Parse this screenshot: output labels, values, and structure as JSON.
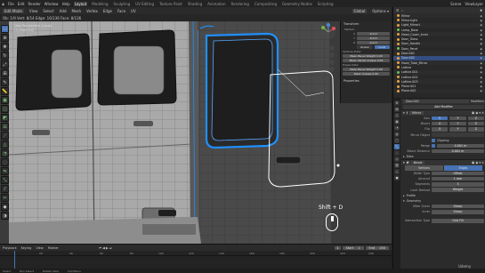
{
  "topbar": {
    "menus": [
      "File",
      "Edit",
      "Render",
      "Window",
      "Help"
    ],
    "workspaces": [
      "Layout",
      "Modeling",
      "Sculpting",
      "UV Editing",
      "Texture Paint",
      "Shading",
      "Animation",
      "Rendering",
      "Compositing",
      "Geometry Nodes",
      "Scripting"
    ],
    "active_workspace": "Layout",
    "scene": "Scene",
    "view_layer": "ViewLayer"
  },
  "viewport_header": {
    "mode": "Edit Mode",
    "menus": [
      "View",
      "Select",
      "Add",
      "Mesh",
      "Vertex",
      "Edge",
      "Face",
      "UV"
    ],
    "orientation": "Global",
    "stats": "Ob: 1/9 Vert: 8/14 Edge: 16/136 Face: 8/136"
  },
  "viewport_overlay": {
    "line1": "User Perspective (Local)",
    "line2": "(1) Door.002"
  },
  "npanel": {
    "title": "Transform",
    "median_label": "Median:",
    "x_label": "X",
    "x_value": "-0.0 m",
    "y_label": "Y",
    "y_value": "-0.0 m",
    "z_label": "Z",
    "z_value": "-0.0 m",
    "global_label": "Global",
    "local_label": "Local",
    "edge_data_label": "Vertices Data:",
    "mean_bevel_label": "Mean Bevel Weight",
    "mean_bevel_value": "0.00",
    "mean_crease_label": "Mean Vertex Crease",
    "mean_crease_value": "0.00",
    "edges_data_label": "Edges Data:",
    "edge_bevel_label": "Mean Bevel Weight",
    "edge_bevel_value": "0.00",
    "edge_crease_label": "Mean Crease",
    "edge_crease_value": "0.00",
    "properties_label": "Properties"
  },
  "hint": {
    "shortcut": "Shift + D"
  },
  "timeline": {
    "menus": [
      "Playback",
      "Keying",
      "View",
      "Marker"
    ],
    "current_frame": "1",
    "start_label": "Start",
    "start": "1",
    "end_label": "End",
    "end": "250",
    "ruler": [
      "20",
      "40",
      "60",
      "80",
      "100",
      "120",
      "140",
      "160",
      "180",
      "200",
      "220",
      "240"
    ]
  },
  "statusbar": {
    "items": [
      "Select",
      "Box Select",
      "Rotate View",
      "Call Menu"
    ]
  },
  "outliner": {
    "items": [
      {
        "name": "Mirror",
        "color": "#e8a33f"
      },
      {
        "name": "MirrorLight",
        "color": "#e8a33f"
      },
      {
        "name": "Light_MirrorL",
        "color": "#e8a33f"
      },
      {
        "name": "Lamp_Base",
        "color": "#6fbf5a"
      },
      {
        "name": "Head_Cover_Inner",
        "color": "#e8a33f"
      },
      {
        "name": "Door_Glass",
        "color": "#e8a33f"
      },
      {
        "name": "Door_Handle",
        "color": "#e8a33f"
      },
      {
        "name": "Door_Panel",
        "color": "#6fbf5a"
      },
      {
        "name": "Door.001",
        "color": "#e8a33f"
      },
      {
        "name": "Door.002",
        "color": "#e8a33f"
      },
      {
        "name": "Hood_Tube_Mirror",
        "color": "#e8a33f"
      },
      {
        "name": "Lattice",
        "color": "#e8a33f"
      },
      {
        "name": "Lattice.001",
        "color": "#6fbf5a"
      },
      {
        "name": "Lattice.002",
        "color": "#e8a33f"
      },
      {
        "name": "Lattice.003",
        "color": "#e8a33f"
      },
      {
        "name": "Plane.001",
        "color": "#e8a33f"
      },
      {
        "name": "Plane.002",
        "color": "#e8a33f"
      }
    ]
  },
  "properties": {
    "object_name": "Door.002",
    "modifier_tab": "Modifiers",
    "add_modifier": "Add Modifier",
    "mirror": {
      "name": "Mirror",
      "axis_label": "Axis",
      "bisect_label": "Bisect",
      "flip_label": "Flip",
      "x": "X",
      "y": "Y",
      "z": "Z",
      "mirror_object_label": "Mirror Object",
      "clipping_label": "Clipping",
      "merge_label": "Merge",
      "merge_value": "0.001 m",
      "bisect_distance_label": "Bisect Distance",
      "bisect_distance_value": "0.001 m",
      "data_label": "Data"
    },
    "bevel": {
      "name": "Bevel",
      "vertices_tab": "Vertices",
      "edges_tab": "Edges",
      "width_type_label": "Width Type",
      "width_type_value": "Offset",
      "amount_label": "Amount",
      "amount_value": "1 mm",
      "segments_label": "Segments",
      "segments_value": "3",
      "limit_method_label": "Limit Method",
      "limit_method_value": "Weight",
      "profile_label": "Profile",
      "geometry_label": "Geometry",
      "miter_outer_label": "Miter Outer",
      "miter_outer_value": "Sharp",
      "inner_label": "Inner",
      "inner_value": "Sharp",
      "intersection_label": "Intersection Type",
      "intersection_value": "Grid Fill"
    }
  },
  "watermark": "Udemy",
  "colors": {
    "accent": "#4772b3",
    "selection": "#1e90ff",
    "vertex": "#ffffff"
  }
}
